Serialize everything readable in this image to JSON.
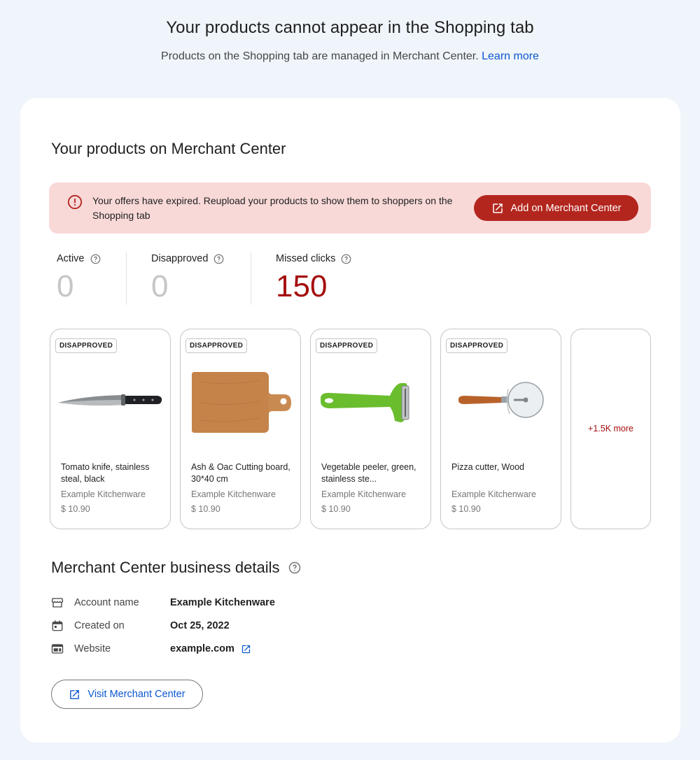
{
  "header": {
    "title": "Your products cannot appear in the Shopping tab",
    "subtitle": "Products on the Shopping tab are managed in Merchant Center.",
    "learn_more": "Learn more"
  },
  "products_section": {
    "title": "Your products on Merchant Center",
    "alert": {
      "icon": "error-icon",
      "text": "Your offers have expired. Reupload your products to show them to shoppers on the Shopping tab",
      "button_label": "Add on Merchant Center",
      "button_icon": "open-in-new-icon"
    },
    "stats": [
      {
        "label": "Active",
        "value": "0"
      },
      {
        "label": "Disapproved",
        "value": "0"
      },
      {
        "label": "Missed clicks",
        "value": "150"
      }
    ],
    "products": [
      {
        "badge": "DISAPPROVED",
        "name": "Tomato knife, stainless steal, black",
        "seller": "Example Kitchenware",
        "price": "$ 10.90",
        "image": "knife"
      },
      {
        "badge": "DISAPPROVED",
        "name": "Ash & Oac Cutting board, 30*40 cm",
        "seller": "Example Kitchenware",
        "price": "$ 10.90",
        "image": "cutting-board"
      },
      {
        "badge": "DISAPPROVED",
        "name": "Vegetable peeler, green, stainless ste...",
        "seller": "Example Kitchenware",
        "price": "$ 10.90",
        "image": "peeler"
      },
      {
        "badge": "DISAPPROVED",
        "name": "Pizza cutter, Wood",
        "seller": "Example Kitchenware",
        "price": "$ 10.90",
        "image": "pizza-cutter"
      }
    ],
    "more_label": "+1.5K more"
  },
  "business_details": {
    "title": "Merchant Center business details",
    "rows": [
      {
        "icon": "storefront-icon",
        "label": "Account name",
        "value": "Example Kitchenware"
      },
      {
        "icon": "calendar-icon",
        "label": "Created on",
        "value": "Oct 25, 2022"
      },
      {
        "icon": "web-icon",
        "label": "Website",
        "value": "example.com"
      }
    ],
    "visit_button": "Visit Merchant Center"
  },
  "colors": {
    "background": "#f0f5fb",
    "alert_bg": "#f8d9d8",
    "primary_red": "#b3261e",
    "link_blue": "#0b57d0"
  }
}
